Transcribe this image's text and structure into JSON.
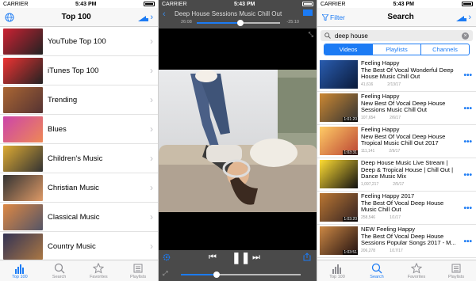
{
  "status": {
    "carrier": "CARRIER",
    "time": "5:43 PM"
  },
  "screen1": {
    "title": "Top 100",
    "items": [
      {
        "label": "YouTube Top 100",
        "colors": [
          "#c23",
          "#222"
        ]
      },
      {
        "label": "iTunes Top 100",
        "colors": [
          "#e33",
          "#222"
        ]
      },
      {
        "label": "Trending",
        "colors": [
          "#a63",
          "#533"
        ]
      },
      {
        "label": "Blues",
        "colors": [
          "#c4a",
          "#e85"
        ]
      },
      {
        "label": "Children's Music",
        "colors": [
          "#da3",
          "#333"
        ]
      },
      {
        "label": "Christian Music",
        "colors": [
          "#333",
          "#d96"
        ]
      },
      {
        "label": "Classical Music",
        "colors": [
          "#d84",
          "#556"
        ]
      },
      {
        "label": "Country Music",
        "colors": [
          "#335",
          "#a74"
        ]
      }
    ],
    "tabs": [
      {
        "label": "Top 100"
      },
      {
        "label": "Search"
      },
      {
        "label": "Favorites"
      },
      {
        "label": "Playlists"
      }
    ]
  },
  "screen2": {
    "title": "Deep House Sessions Music Chill Out",
    "time_elapsed": "26:08",
    "time_remaining": "-25:10",
    "progress": 0.52,
    "volume": 0.3
  },
  "screen3": {
    "left_action": "Filter",
    "title": "Search",
    "query": "deep house",
    "segments": [
      "Videos",
      "Playlists",
      "Channels"
    ],
    "results": [
      {
        "title": "Feeling Happy\nThe Best Of Vocal Wonderful Deep House Music Chill Out",
        "views": "41,616",
        "date": "2/13/17",
        "duration": "",
        "colors": [
          "#2a5db0",
          "#0a1a3a"
        ]
      },
      {
        "title": "Feeling Happy\nNew Best Of Vocal Deep House Sessions Music Chill Out",
        "views": "107,654",
        "date": "2/6/17",
        "duration": "1:01:20",
        "colors": [
          "#c83",
          "#333"
        ]
      },
      {
        "title": "Feeling Happy\nNew Best Of Vocal Deep House Tropical Music Chill Out 2017",
        "views": "111,141",
        "date": "2/9/17",
        "duration": "1:03:31",
        "colors": [
          "#fc6",
          "#b43"
        ]
      },
      {
        "title": "Deep House Music Live Stream | Deep & Tropical House | Chill Out | Dance Music Mix",
        "views": "1,097,217",
        "date": "2/5/17",
        "duration": "",
        "colors": [
          "#fd3",
          "#111"
        ]
      },
      {
        "title": "Feeling Happy 2017\nThe Best Of Vocal Deep House Music Chill Out",
        "views": "258,546",
        "date": "1/1/17",
        "duration": "1:03:20",
        "colors": [
          "#b73",
          "#322"
        ]
      },
      {
        "title": "NEW Feeling Happy\nThe Best Of Vocal Deep House Sessions Popular Songs 2017 - M...",
        "views": "206,278",
        "date": "1/17/17",
        "duration": "1:03:51",
        "colors": [
          "#c84",
          "#211"
        ]
      },
      {
        "title": "New Deep House 2017 Mix & Chillout Music #6\nBest Remixes 2017",
        "views": "",
        "date": "",
        "duration": "",
        "colors": [
          "#ea4",
          "#245"
        ]
      }
    ],
    "tabs": [
      {
        "label": "Top 100"
      },
      {
        "label": "Search"
      },
      {
        "label": "Favorites"
      },
      {
        "label": "Playlists"
      }
    ]
  },
  "colors": {
    "accent": "#1c7bf4"
  },
  "icons": [
    "globe-icon",
    "music-bars-icon",
    "chevron-right-icon",
    "filter-icon",
    "magnifier-icon",
    "star-icon",
    "playlist-icon",
    "gear-icon",
    "share-icon",
    "more-dots-icon"
  ]
}
